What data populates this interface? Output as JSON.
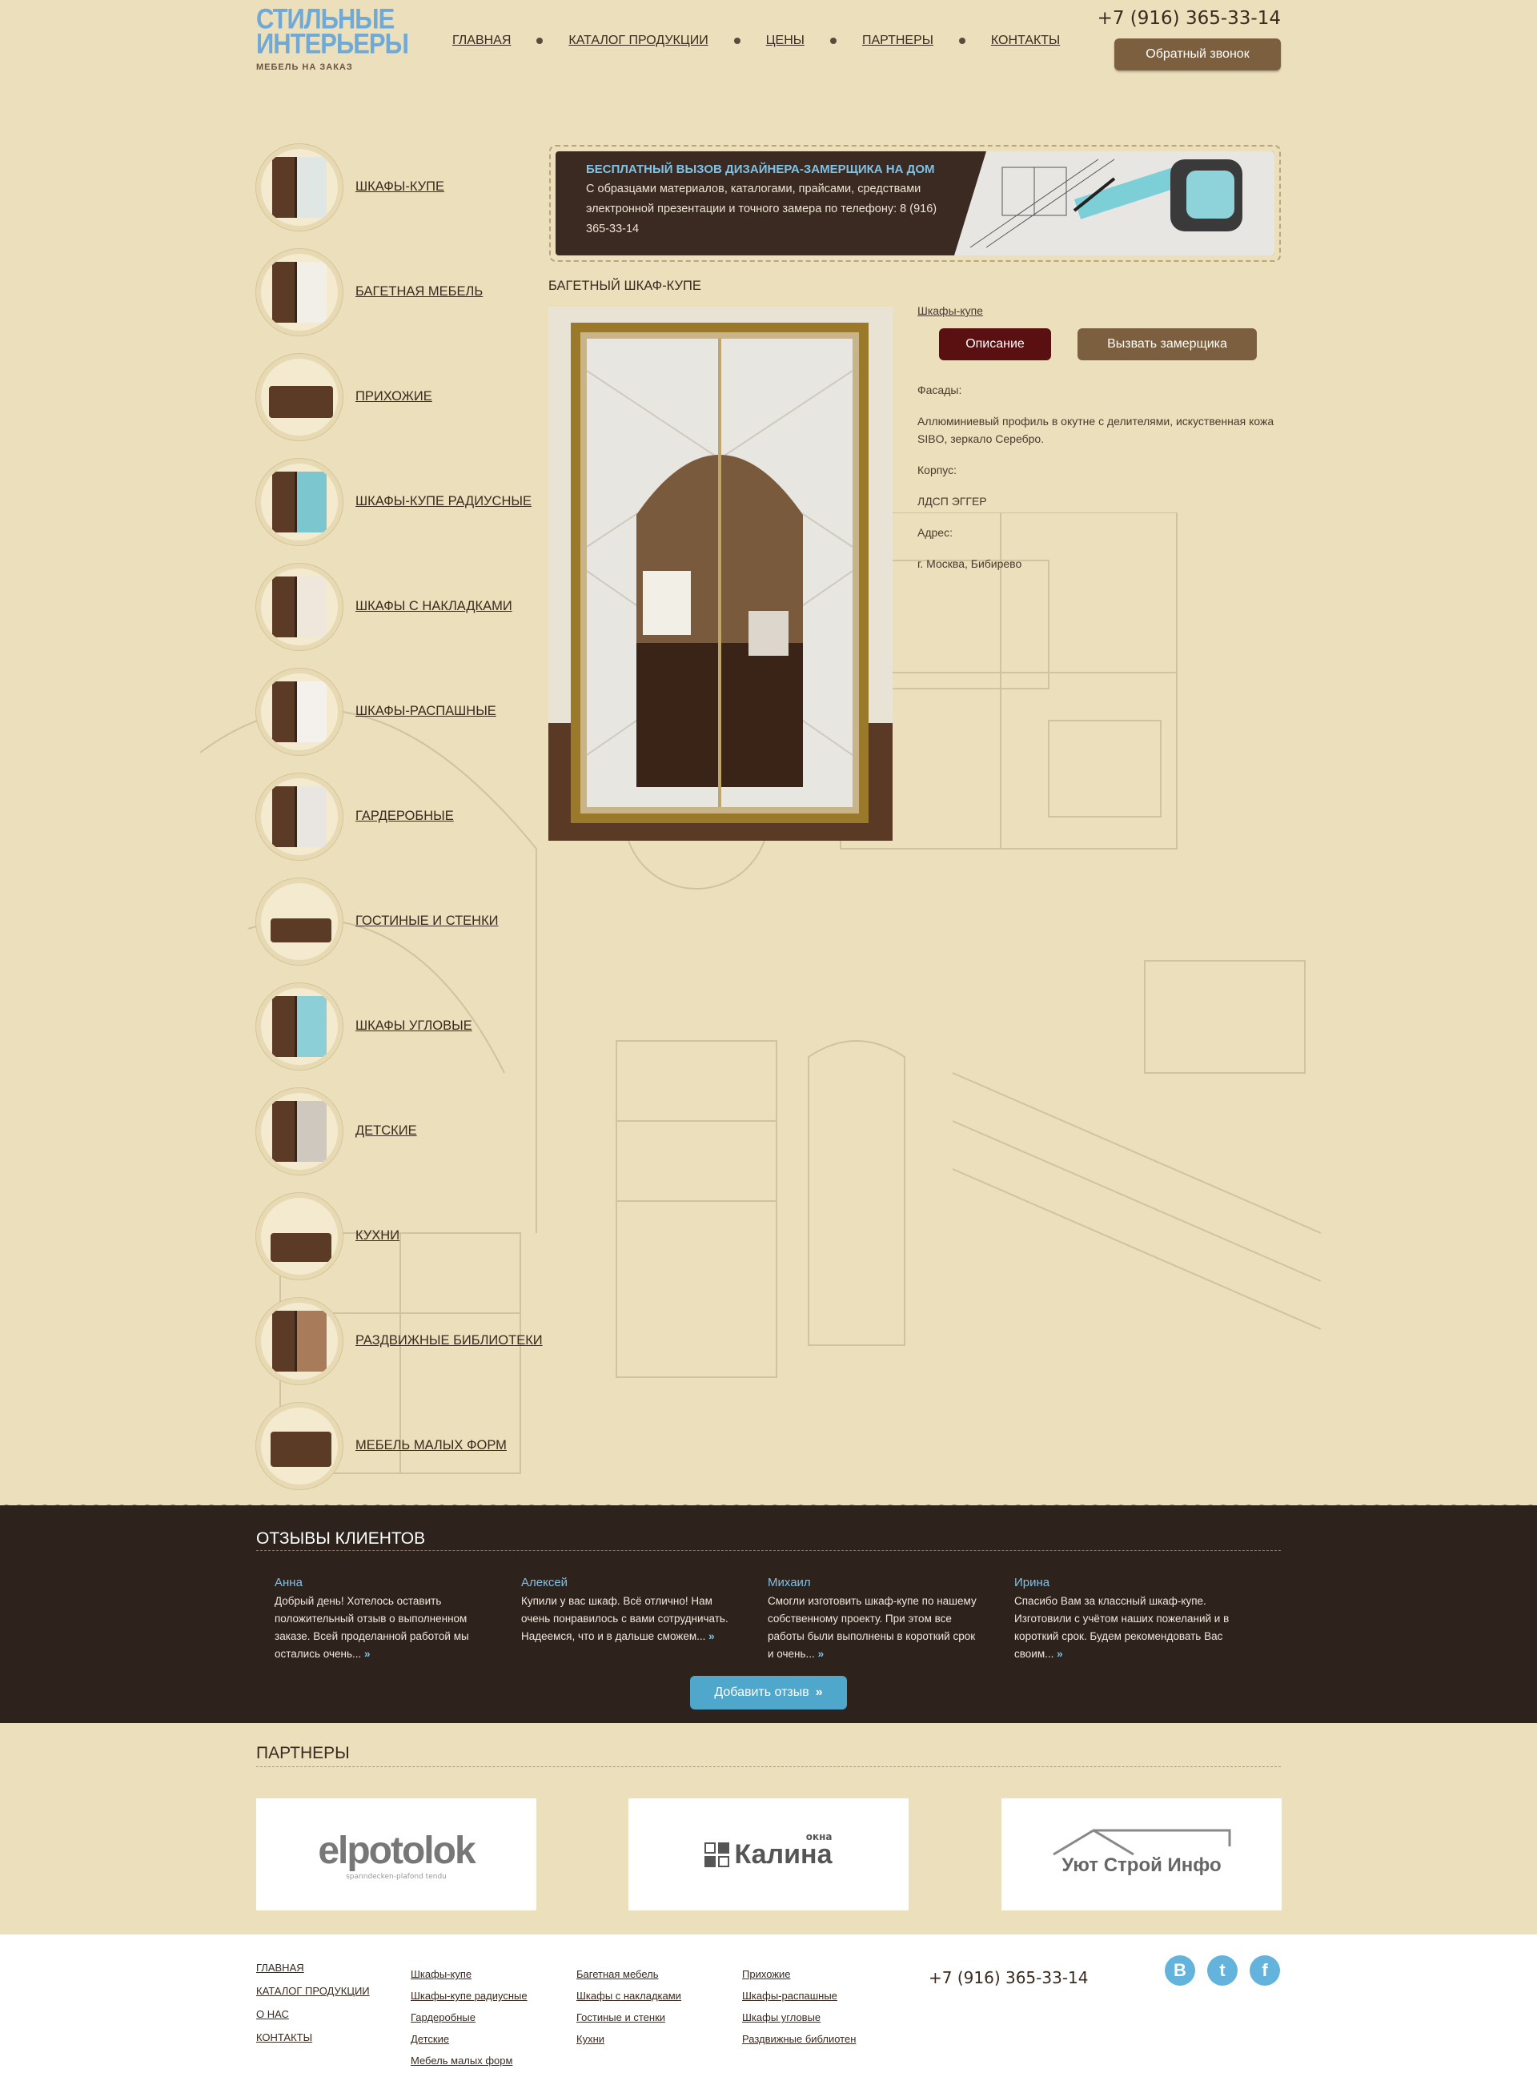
{
  "brand": {
    "line1": "Стильные",
    "line2": "Интерьеры",
    "tagline": "мебель на заказ",
    "accent": "#6fa9d8"
  },
  "nav": [
    "Главная",
    "Каталог продукции",
    "Цены",
    "Партнеры",
    "Контакты"
  ],
  "header": {
    "phone": "+7 (916) 365-33-14",
    "callback": "Обратный звонок"
  },
  "categories": [
    {
      "label": "Шкафы-купе",
      "icon": "wardrobe-icon"
    },
    {
      "label": "Багетная мебель",
      "icon": "baguette-furniture-icon"
    },
    {
      "label": "Прихожие",
      "icon": "hallway-icon"
    },
    {
      "label": "Шкафы-купе радиусные",
      "icon": "radius-wardrobe-icon"
    },
    {
      "label": "Шкафы с накладками",
      "icon": "overlay-wardrobe-icon"
    },
    {
      "label": "Шкафы-распашные",
      "icon": "swing-wardrobe-icon"
    },
    {
      "label": "Гардеробные",
      "icon": "dressing-room-icon"
    },
    {
      "label": "Гостиные и стенки",
      "icon": "living-room-icon"
    },
    {
      "label": "Шкафы угловые",
      "icon": "corner-wardrobe-icon"
    },
    {
      "label": "Детские",
      "icon": "kids-room-icon"
    },
    {
      "label": "Кухни",
      "icon": "kitchen-icon"
    },
    {
      "label": "Раздвижные библиотеки",
      "icon": "sliding-library-icon"
    },
    {
      "label": "Мебель малых форм",
      "icon": "small-furniture-icon"
    }
  ],
  "banner": {
    "title": "БЕСПЛАТНЫЙ ВЫЗОВ ДИЗАЙНЕРА-ЗАМЕРЩИКА НА ДОМ",
    "text": "С образцами материалов, каталогами, прайсами, средствами электронной презентации и точного замера по телефону: 8 (916) 365-33-14"
  },
  "product": {
    "title": "Багетный шкаф-купе",
    "breadcrumb": "Шкафы-купе",
    "tab_description": "Описание",
    "tab_measure": "Вызвать замерщика",
    "facades_label": "Фасады:",
    "facades_value": "Аллюминиевый профиль в окутне с делителями, искуственная кожа SIBO, зеркало Серебро.",
    "body_label": "Корпус:",
    "body_value": "ЛДСП ЭГГЕР",
    "address_label": "Адрес:",
    "address_value": "г. Москва, Бибирево"
  },
  "reviews": {
    "title": "Отзывы клиентов",
    "items": [
      {
        "name": "Анна",
        "text": "Добрый день! Хотелось оставить положительный отзыв о выполненном заказе. Всей проделанной работой мы остались очень..."
      },
      {
        "name": "Алексей",
        "text": "Купили у вас шкаф. Всё отлично! Нам очень понравилось с вами сотрудничать. Надеемся, что и в дальше сможем..."
      },
      {
        "name": "Михаил",
        "text": "Смогли изготовить шкаф-купе по нашему собственному проекту. При этом все работы были выполнены в короткий срок и очень..."
      },
      {
        "name": "Ирина",
        "text": "Спасибо Вам за классный шкаф-купе. Изготовили с учётом наших пожеланий и в короткий срок. Будем рекомендовать Вас своим..."
      }
    ],
    "more_glyph": "»",
    "add_button": "Добавить отзыв"
  },
  "partners": {
    "title": "Партнеры",
    "logos": [
      {
        "name": "elpotolok",
        "sub": "spanndecken-plafond tendu"
      },
      {
        "name": "Калина",
        "sub": "окна"
      },
      {
        "name": "Уют Строй Инфо"
      }
    ]
  },
  "footer": {
    "main_links": [
      "Главная",
      "Каталог продукции",
      "О нас",
      "Контакты"
    ],
    "col1": [
      "Шкафы-купе",
      "Шкафы-купе радиусные",
      "Гардеробные",
      "Детские",
      "Мебель малых форм"
    ],
    "col2": [
      "Багетная мебель",
      "Шкафы с накладками",
      "Гостиные и стенки",
      "Кухни"
    ],
    "col3": [
      "Прихожие",
      "Шкафы-распашные",
      "Шкафы угловые",
      "Раздвижные библиотен"
    ],
    "phone": "+7 (916) 365-33-14",
    "social": [
      {
        "name": "vk-icon",
        "glyph": "В"
      },
      {
        "name": "twitter-icon",
        "glyph": "t"
      },
      {
        "name": "facebook-icon",
        "glyph": "f"
      }
    ]
  },
  "colors": {
    "page_bg": "#ecdfbb",
    "dark_band": "#2d221c",
    "button_brown": "#7c5f3e",
    "tab_active": "#5a0f10",
    "accent_blue": "#4fa8cc"
  }
}
